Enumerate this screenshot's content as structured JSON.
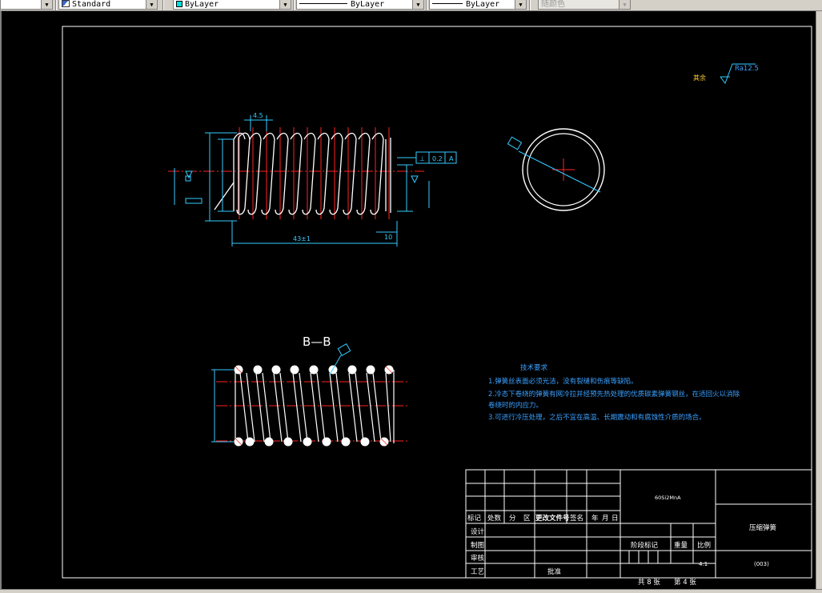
{
  "toolbar": {
    "textstyle": "Standard",
    "layer": "ByLayer",
    "linetype": "ByLayer",
    "lineweight": "ByLayer",
    "plotstyle": "随颜色"
  },
  "drawing": {
    "roughness_symbol_value": "Ra12.5",
    "roughness_rest_label": "其余",
    "section_label": "B—B",
    "dim_pitch": "4.5",
    "dim_length": "43±1",
    "dim_end": "10",
    "tolerance_frame": [
      "⊥",
      "0.2",
      "A"
    ],
    "tech_requirements": {
      "title": "技术要求",
      "lines": [
        "1.弹簧丝表面必须光洁，没有裂缝和伤痕等缺陷。",
        "2.冷态下卷绕的弹簧有网冷拉并经预先热处理的优质碳素弹簧钢丝，在适回火以消除",
        "卷绕时的内应力。",
        "3.可进行冷压处理，之后不宜在高温、长期震动和有腐蚀性介质的场合。"
      ]
    }
  },
  "title_block": {
    "material": "60Si2MnA",
    "part_name": "压缩弹簧",
    "drawing_number": "(003)",
    "header_row": [
      "标记",
      "处数",
      "分",
      "区",
      "更改文件号",
      "签名",
      "年",
      "月",
      "日"
    ],
    "role_labels": [
      "设计",
      "制图",
      "审核",
      "工艺"
    ],
    "approve_label": "批准",
    "stage_mark_label": "阶段标记",
    "weight_label": "重量",
    "scale_label": "比例",
    "scale_value": "4:1",
    "sheet_total": "共 8 张",
    "sheet_index": "第 4 张"
  }
}
